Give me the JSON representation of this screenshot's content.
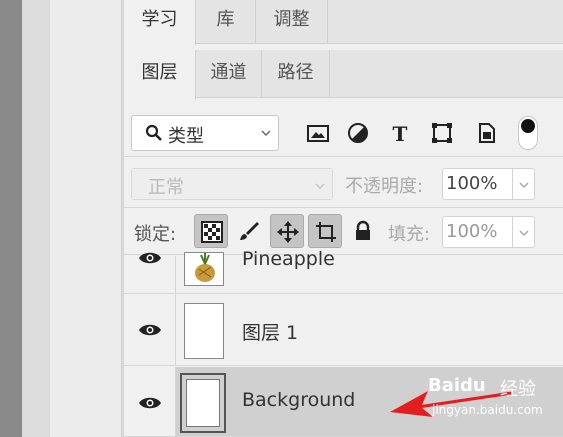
{
  "tabs_top": [
    "学习",
    "库",
    "调整"
  ],
  "tabs_sub": [
    "图层",
    "通道",
    "路径"
  ],
  "filter": {
    "kind_label": "类型"
  },
  "blend": {
    "mode": "正常",
    "opacity_label": "不透明度:",
    "opacity_value": "100%"
  },
  "lock": {
    "label": "锁定:",
    "fill_label": "填充:",
    "fill_value": "100%"
  },
  "layers": [
    {
      "name": "Pineapple",
      "visible": true
    },
    {
      "name": "图层 1",
      "visible": true
    },
    {
      "name": "Background",
      "visible": true,
      "selected": true
    }
  ],
  "colors": {
    "annotation_arrow": "#e41e1e",
    "selected_layer": "#d0d0d0"
  },
  "watermark": {
    "logo": "Baidu",
    "label": "经验",
    "url": "jingyan.baidu.com"
  }
}
